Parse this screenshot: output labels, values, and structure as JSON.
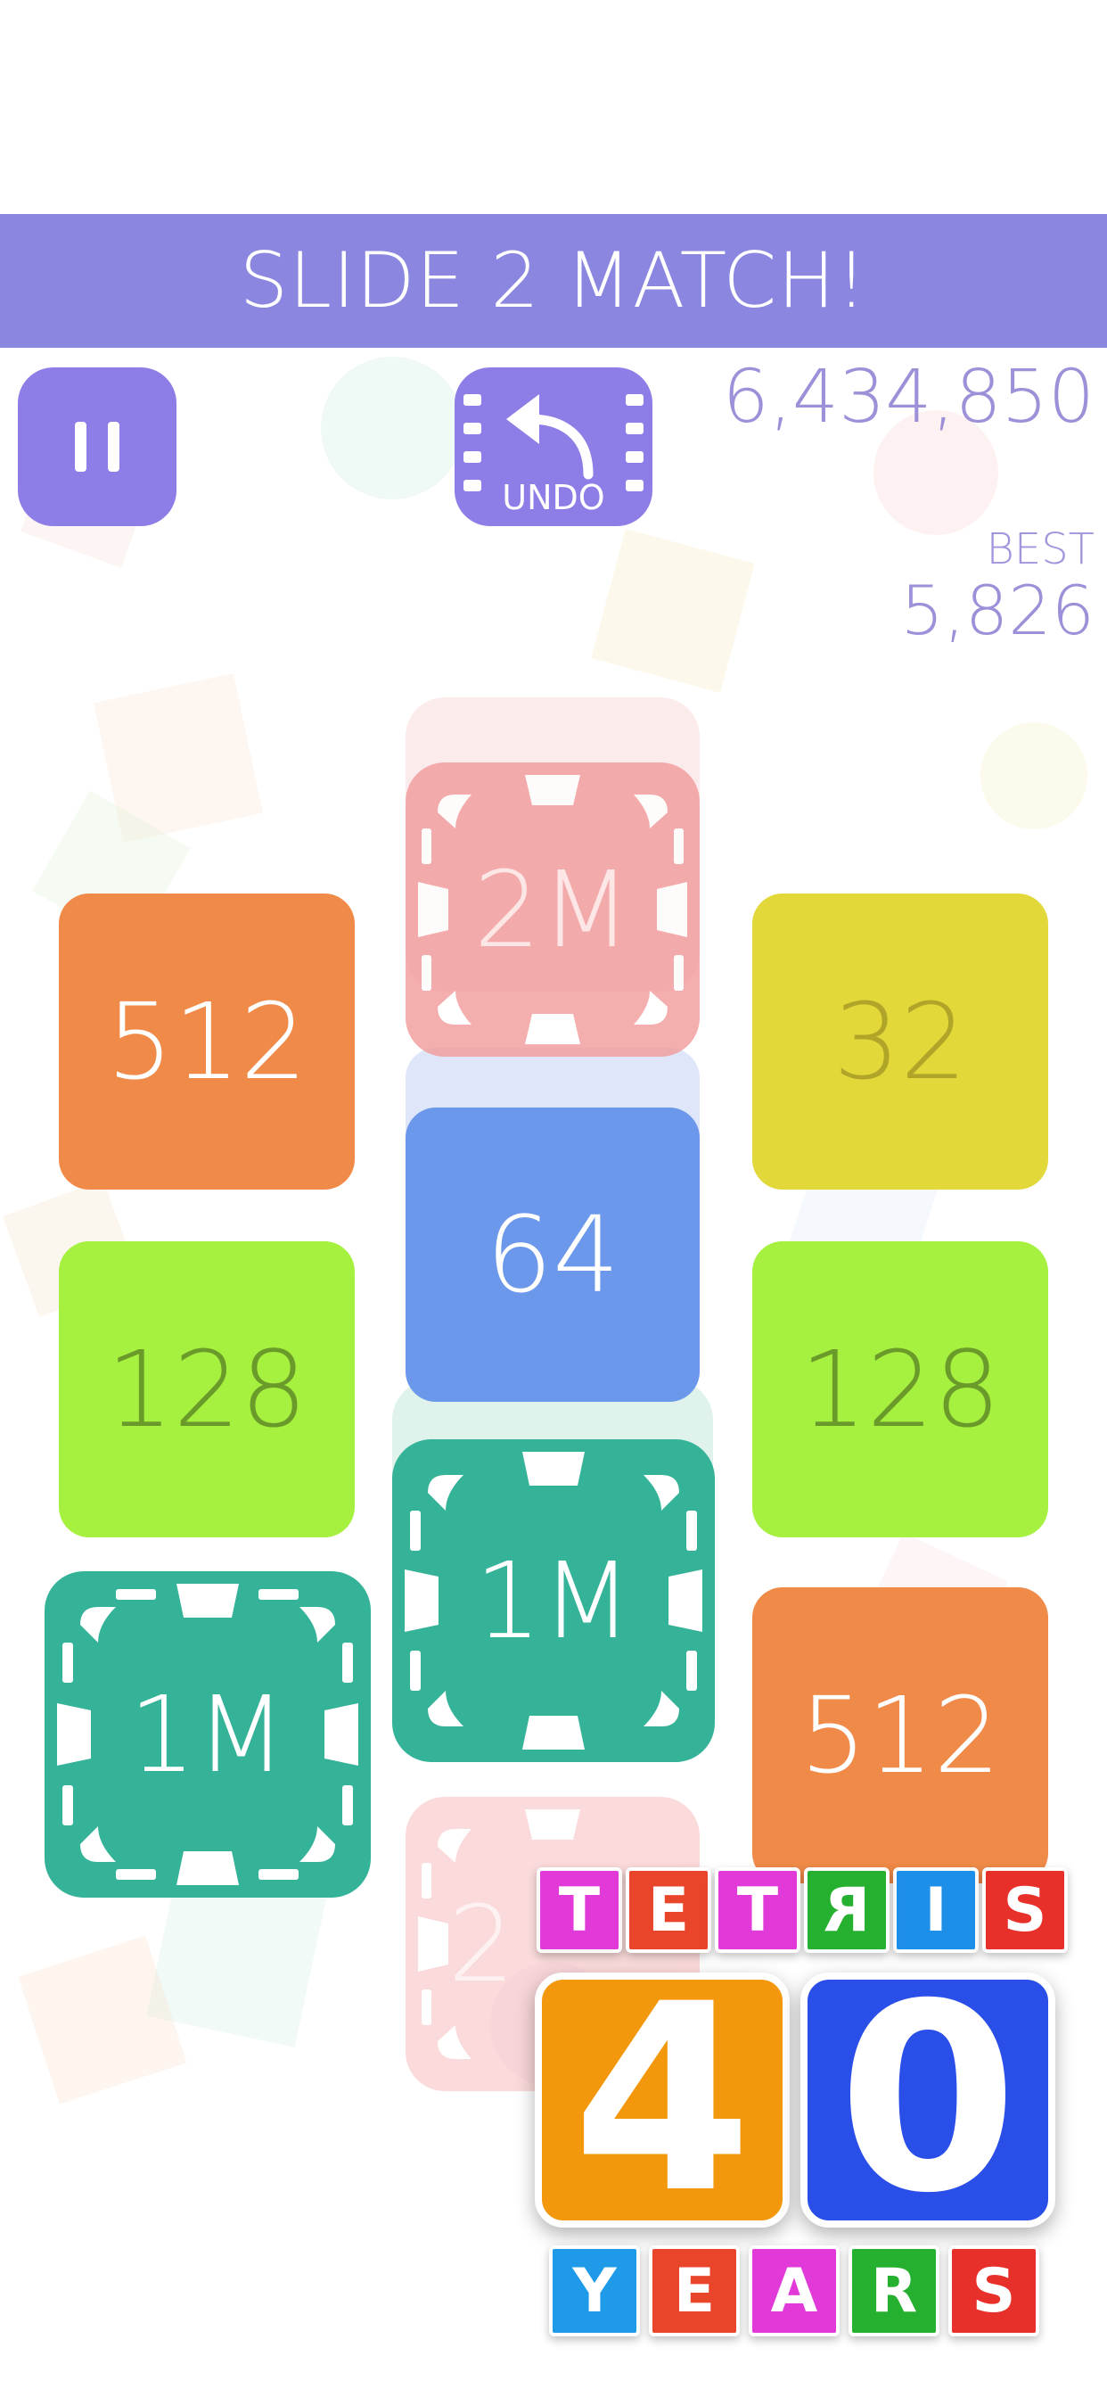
{
  "header": {
    "title": "SLIDE 2 MATCH!"
  },
  "controls": {
    "pause_icon": "pause-icon",
    "undo_icon": "undo-arrow-icon",
    "undo_label": "UNDO"
  },
  "score": {
    "current": "6,434,850",
    "best_label": "BEST",
    "best": "5,826"
  },
  "colors": {
    "banner": "#8b86e0",
    "button": "#8d7de6",
    "score_text": "#9d8fd8",
    "tile_512": "#f08a48",
    "tile_32": "#e2d83a",
    "tile_128": "#a6f040",
    "tile_64": "#6b98ea",
    "tile_1m": "#35b399",
    "tile_2m": "#f29b9b"
  },
  "tiles": {
    "left_col": [
      "512",
      "128",
      "1M"
    ],
    "center_col": [
      "2M",
      "64",
      "1M"
    ],
    "right_col": [
      "32",
      "128",
      "512"
    ],
    "ghost_bottom_partial": "2"
  },
  "promo": {
    "top_letters": [
      "T",
      "E",
      "T",
      "R",
      "I",
      "S"
    ],
    "digits": [
      "4",
      "0"
    ],
    "bottom_letters": [
      "Y",
      "E",
      "A",
      "R",
      "S"
    ]
  }
}
